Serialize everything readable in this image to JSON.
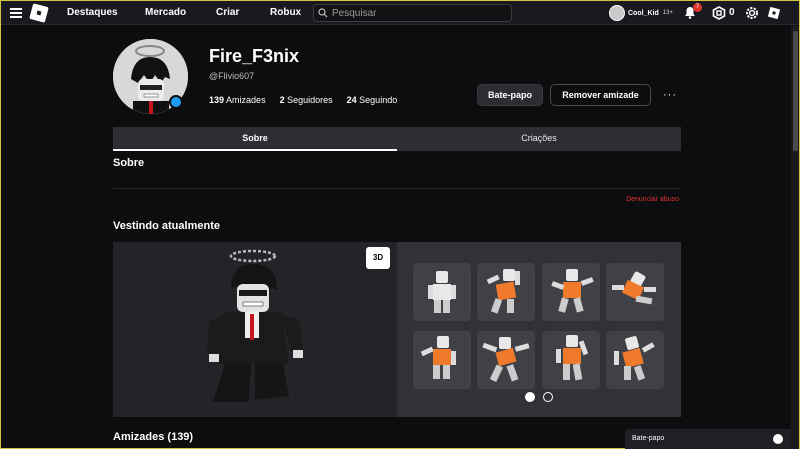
{
  "nav": {
    "links": [
      "Destaques",
      "Mercado",
      "Criar",
      "Robux"
    ],
    "search_placeholder": "Pesquisar",
    "username": "Cool_Kid",
    "age_label": "13+",
    "notification_count": "7",
    "robux_count": "0"
  },
  "profile": {
    "display_name": "Fire_F3nix",
    "handle": "@Flivio607",
    "friends_count": "139",
    "friends_label": "Amizades",
    "followers_count": "2",
    "followers_label": "Seguidores",
    "following_count": "24",
    "following_label": "Seguindo",
    "chat_button": "Bate-papo",
    "remove_friend_button": "Remover amizade",
    "more": "···"
  },
  "tabs": [
    "Sobre",
    "Criações"
  ],
  "about": {
    "title": "Sobre",
    "report": "Denunciar abuso"
  },
  "wearing": {
    "title": "Vestindo atualmente",
    "view_3d": "3D",
    "page_count": 2,
    "active_page": 1
  },
  "friends_section": {
    "title": "Amizades (139)"
  },
  "chat_bar": {
    "label": "Bate-papo"
  },
  "colors": {
    "accent_blue": "#1d9bf0",
    "report_red": "#e0352f",
    "nav_bg": "#191a1f",
    "page_bg": "#0c0d0f"
  }
}
